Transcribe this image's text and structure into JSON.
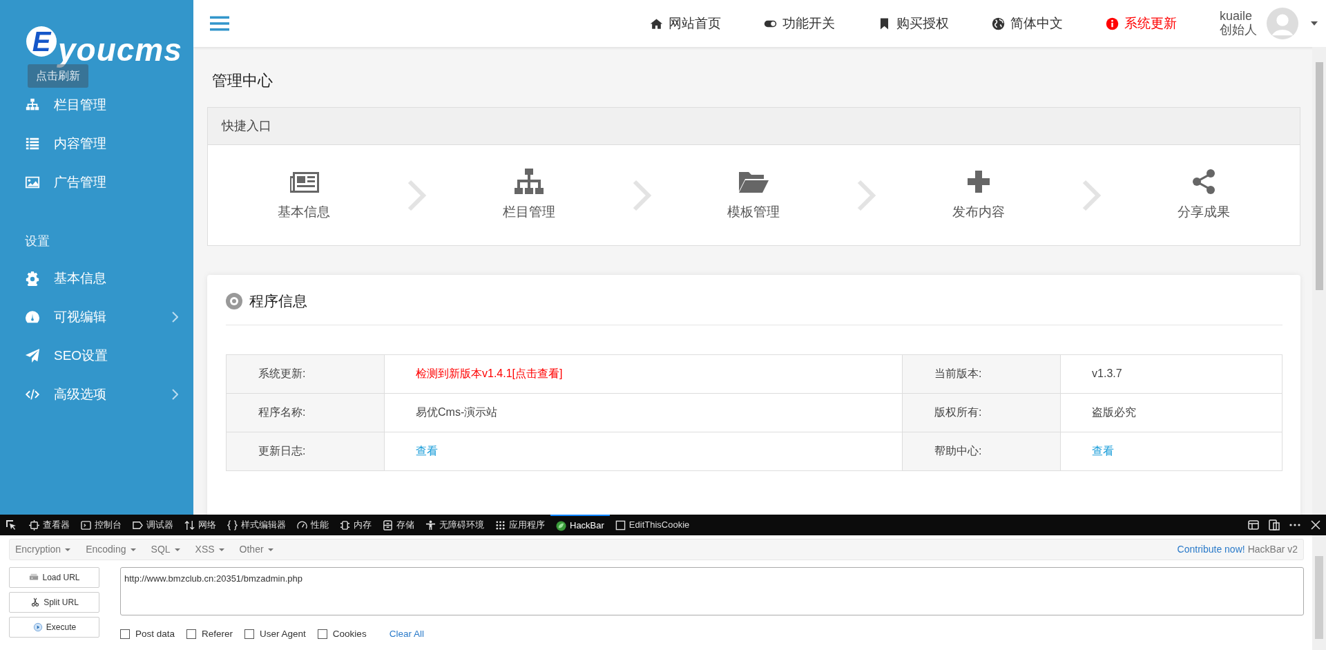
{
  "sidebar": {
    "logo": {
      "letter": "E",
      "text": "youcms"
    },
    "tooltip": "点击刷新",
    "items": [
      {
        "label": "栏目管理",
        "has_submenu": false
      },
      {
        "label": "内容管理",
        "has_submenu": false
      },
      {
        "label": "广告管理",
        "has_submenu": false
      }
    ],
    "section": "设置",
    "settings_items": [
      {
        "label": "基本信息",
        "has_submenu": false
      },
      {
        "label": "可视编辑",
        "has_submenu": true
      },
      {
        "label": "SEO设置",
        "has_submenu": false
      },
      {
        "label": "高级选项",
        "has_submenu": true
      }
    ]
  },
  "topbar": {
    "nav": [
      {
        "label": "网站首页",
        "kind": "normal"
      },
      {
        "label": "功能开关",
        "kind": "normal"
      },
      {
        "label": "购买授权",
        "kind": "normal"
      },
      {
        "label": "简体中文",
        "kind": "normal"
      },
      {
        "label": "系统更新",
        "kind": "alert"
      }
    ],
    "user": {
      "name": "kuaile",
      "role": "创始人"
    }
  },
  "page_title": "管理中心",
  "quick_entry": {
    "title": "快捷入口",
    "items": [
      "基本信息",
      "栏目管理",
      "模板管理",
      "发布内容",
      "分享成果"
    ]
  },
  "program_info": {
    "title": "程序信息",
    "rows": [
      [
        {
          "label": "系统更新:",
          "value": "检测到新版本v1.4.1[点击查看]",
          "kind": "alert"
        },
        {
          "label": "当前版本:",
          "value": "v1.3.7",
          "kind": "text"
        }
      ],
      [
        {
          "label": "程序名称:",
          "value": "易优Cms-演示站",
          "kind": "text"
        },
        {
          "label": "版权所有:",
          "value": "盗版必究",
          "kind": "text"
        }
      ],
      [
        {
          "label": "更新日志:",
          "value": "查看",
          "kind": "link"
        },
        {
          "label": "帮助中心:",
          "value": "查看",
          "kind": "link"
        }
      ]
    ]
  },
  "devtools": {
    "tabs": [
      {
        "label": "查看器",
        "selected": false
      },
      {
        "label": "控制台",
        "selected": false
      },
      {
        "label": "调试器",
        "selected": false
      },
      {
        "label": "网络",
        "selected": false
      },
      {
        "label": "样式编辑器",
        "selected": false
      },
      {
        "label": "性能",
        "selected": false
      },
      {
        "label": "内存",
        "selected": false
      },
      {
        "label": "存储",
        "selected": false
      },
      {
        "label": "无障碍环境",
        "selected": false
      },
      {
        "label": "应用程序",
        "selected": false
      },
      {
        "label": "HackBar",
        "selected": true
      },
      {
        "label": "EditThisCookie",
        "selected": false
      }
    ]
  },
  "hackbar": {
    "menus": [
      "Encryption",
      "Encoding",
      "SQL",
      "XSS",
      "Other"
    ],
    "contribute": "Contribute now!",
    "version": "HackBar v2",
    "buttons": [
      "Load URL",
      "Split URL",
      "Execute"
    ],
    "url": "http://www.bmzclub.cn:20351/bmzadmin.php",
    "options": [
      {
        "label": "Post data",
        "checked": false
      },
      {
        "label": "Referer",
        "checked": false
      },
      {
        "label": "User Agent",
        "checked": false
      },
      {
        "label": "Cookies",
        "checked": false
      }
    ],
    "clear": "Clear All"
  }
}
